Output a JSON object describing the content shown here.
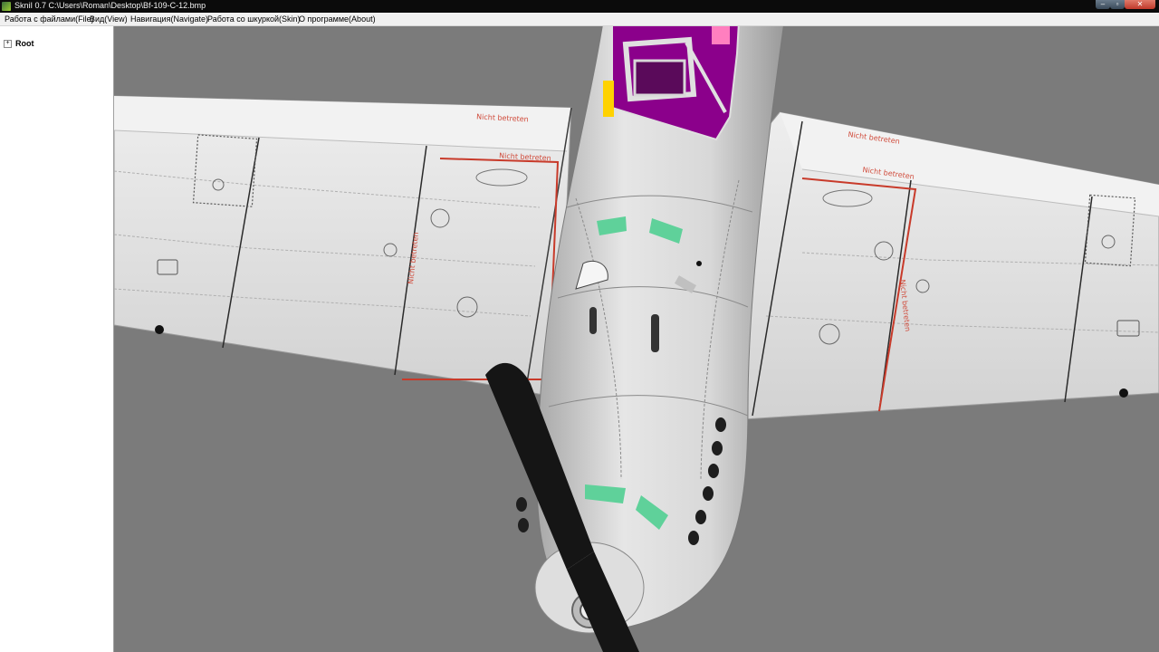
{
  "window": {
    "title": "SkniI 0.7   C:\\Users\\Roman\\Desktop\\Bf-109-C-12.bmp",
    "minimize_glyph": "–",
    "maximize_glyph": "▫",
    "close_glyph": "✕"
  },
  "menu": {
    "items": [
      {
        "label": "Работа с файлами(File)"
      },
      {
        "label": "Вид(View)"
      },
      {
        "label": "Навигация(Navigate)"
      },
      {
        "label": "Работа со шкуркой(Skin)"
      },
      {
        "label": "О программе(About)"
      }
    ]
  },
  "tree": {
    "expander": "+",
    "root_label": "Root"
  },
  "viewport": {
    "background": "#7b7b7b",
    "stencil_text": "Nicht betreten",
    "colors": {
      "skin": "#e4e4e4",
      "stencil": "#d04a3a",
      "canopy": "#8b008b",
      "propeller": "#151515",
      "exhaust_glass": "#5fd19a"
    }
  },
  "icons": {
    "app": "app-icon",
    "expander": "expand-icon"
  }
}
